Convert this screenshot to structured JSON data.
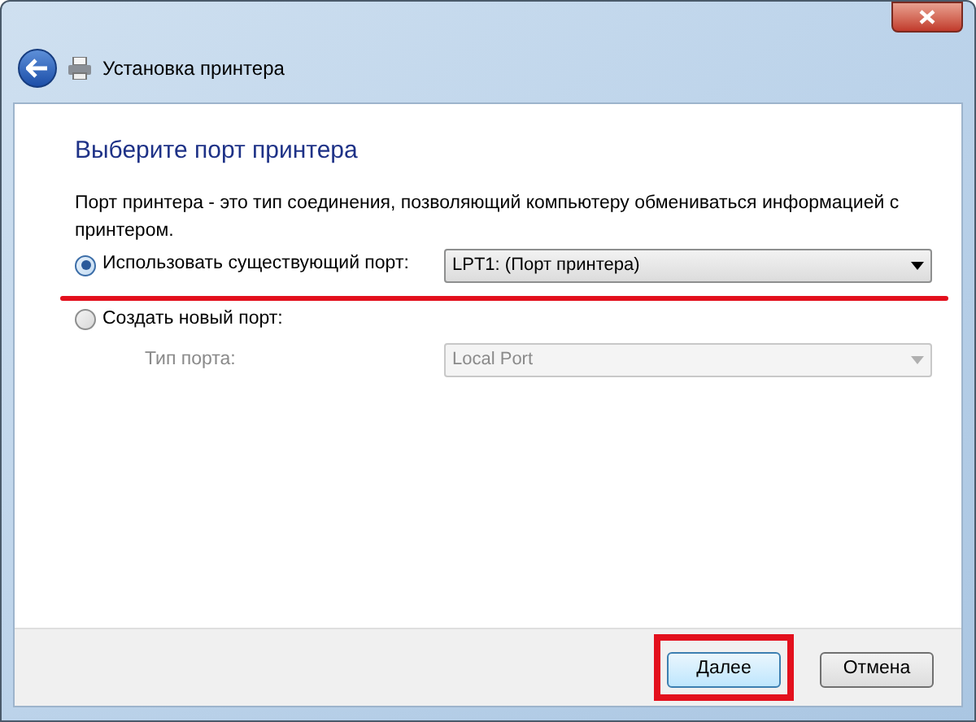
{
  "window": {
    "title": "Установка принтера"
  },
  "heading": "Выберите порт принтера",
  "description": "Порт принтера - это тип соединения, позволяющий компьютеру обмениваться информацией с принтером.",
  "options": [
    {
      "label": "Использовать существующий порт:",
      "selected": true,
      "dropdown": {
        "value": "LPT1: (Порт принтера)",
        "disabled": false
      }
    },
    {
      "label": "Создать новый порт:",
      "selected": false,
      "sub_label": "Тип порта:",
      "dropdown": {
        "value": "Local Port",
        "disabled": true
      }
    }
  ],
  "buttons": [
    {
      "label": "Далее",
      "default": true,
      "highlighted": true
    },
    {
      "label": "Отмена",
      "default": false,
      "highlighted": false
    }
  ]
}
